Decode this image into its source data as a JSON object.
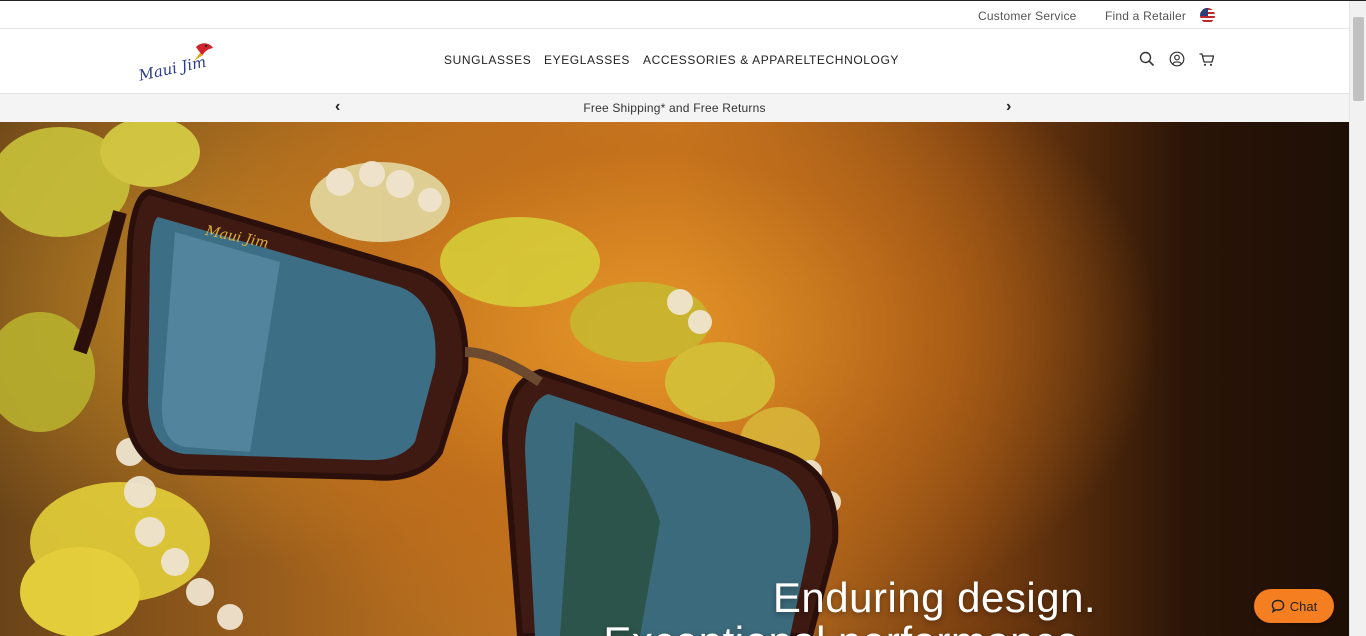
{
  "utility": {
    "customer_service": "Customer Service",
    "find_retailer": "Find a Retailer",
    "flag_icon": "us-flag-icon"
  },
  "brand": {
    "logo_text": "Maui Jim"
  },
  "nav": {
    "items": [
      "SUNGLASSES",
      "EYEGLASSES",
      "ACCESSORIES & APPAREL",
      "TECHNOLOGY"
    ],
    "icons": [
      "search-icon",
      "account-icon",
      "cart-icon"
    ]
  },
  "promo": {
    "prev": "‹",
    "next": "›",
    "text": "Free Shipping* and Free Returns"
  },
  "hero": {
    "line1": "Enduring design.",
    "line2": "Exceptional performance."
  },
  "chat": {
    "label": "Chat"
  },
  "colors": {
    "accent": "#f57f20",
    "brand_blue": "#2a3a8c",
    "brand_red": "#d2232a"
  }
}
